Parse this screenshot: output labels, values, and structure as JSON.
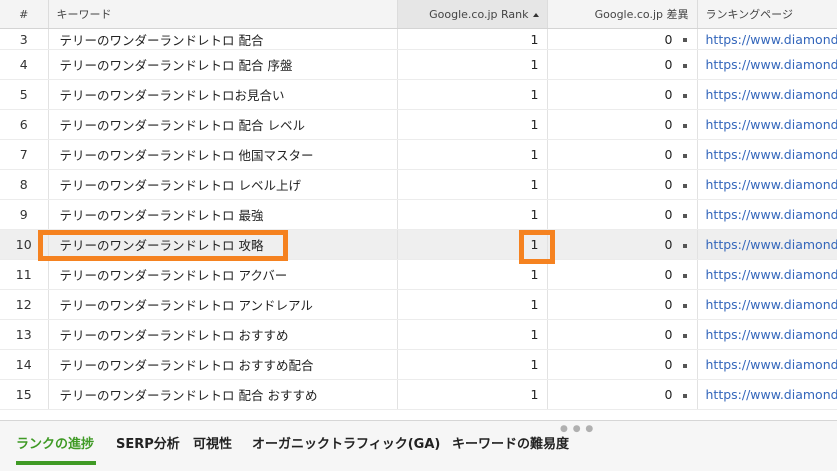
{
  "table": {
    "headers": {
      "num": "#",
      "keyword": "キーワード",
      "rank": "Google.co.jp Rank",
      "diff": "Google.co.jp 差異",
      "page": "ランキングページ"
    },
    "rows": [
      {
        "num": "3",
        "keyword": "テリーのワンダーランドレトロ 配合",
        "rank": "1",
        "diff": "0",
        "page": "https://www.diamond-sta"
      },
      {
        "num": "4",
        "keyword": "テリーのワンダーランドレトロ 配合 序盤",
        "rank": "1",
        "diff": "0",
        "page": "https://www.diamond-sta"
      },
      {
        "num": "5",
        "keyword": "テリーのワンダーランドレトロお見合い",
        "rank": "1",
        "diff": "0",
        "page": "https://www.diamond-sta"
      },
      {
        "num": "6",
        "keyword": "テリーのワンダーランドレトロ 配合 レベル",
        "rank": "1",
        "diff": "0",
        "page": "https://www.diamond-sta"
      },
      {
        "num": "7",
        "keyword": "テリーのワンダーランドレトロ 他国マスター",
        "rank": "1",
        "diff": "0",
        "page": "https://www.diamond-sta"
      },
      {
        "num": "8",
        "keyword": "テリーのワンダーランドレトロ レベル上げ",
        "rank": "1",
        "diff": "0",
        "page": "https://www.diamond-sta"
      },
      {
        "num": "9",
        "keyword": "テリーのワンダーランドレトロ 最強",
        "rank": "1",
        "diff": "0",
        "page": "https://www.diamond-sta"
      },
      {
        "num": "10",
        "keyword": "テリーのワンダーランドレトロ 攻略",
        "rank": "1",
        "diff": "0",
        "page": "https://www.diamond-sta"
      },
      {
        "num": "11",
        "keyword": "テリーのワンダーランドレトロ アクバー",
        "rank": "1",
        "diff": "0",
        "page": "https://www.diamond-sta"
      },
      {
        "num": "12",
        "keyword": "テリーのワンダーランドレトロ アンドレアル",
        "rank": "1",
        "diff": "0",
        "page": "https://www.diamond-sta"
      },
      {
        "num": "13",
        "keyword": "テリーのワンダーランドレトロ おすすめ",
        "rank": "1",
        "diff": "0",
        "page": "https://www.diamond-sta"
      },
      {
        "num": "14",
        "keyword": "テリーのワンダーランドレトロ おすすめ配合",
        "rank": "1",
        "diff": "0",
        "page": "https://www.diamond-sta"
      },
      {
        "num": "15",
        "keyword": "テリーのワンダーランドレトロ 配合 おすすめ",
        "rank": "1",
        "diff": "0",
        "page": "https://www.diamond-sta"
      }
    ]
  },
  "tabs": [
    {
      "label": "ランクの進捗",
      "active": true
    },
    {
      "label": "SERP分析",
      "active": false
    },
    {
      "label": "可視性",
      "active": false
    },
    {
      "label": "オーガニックトラフィック(GA)",
      "active": false
    },
    {
      "label": "キーワードの難易度",
      "active": false
    }
  ],
  "colors": {
    "highlight": "#f58220",
    "active_tab": "#3f9a25",
    "link": "#3366bb"
  }
}
